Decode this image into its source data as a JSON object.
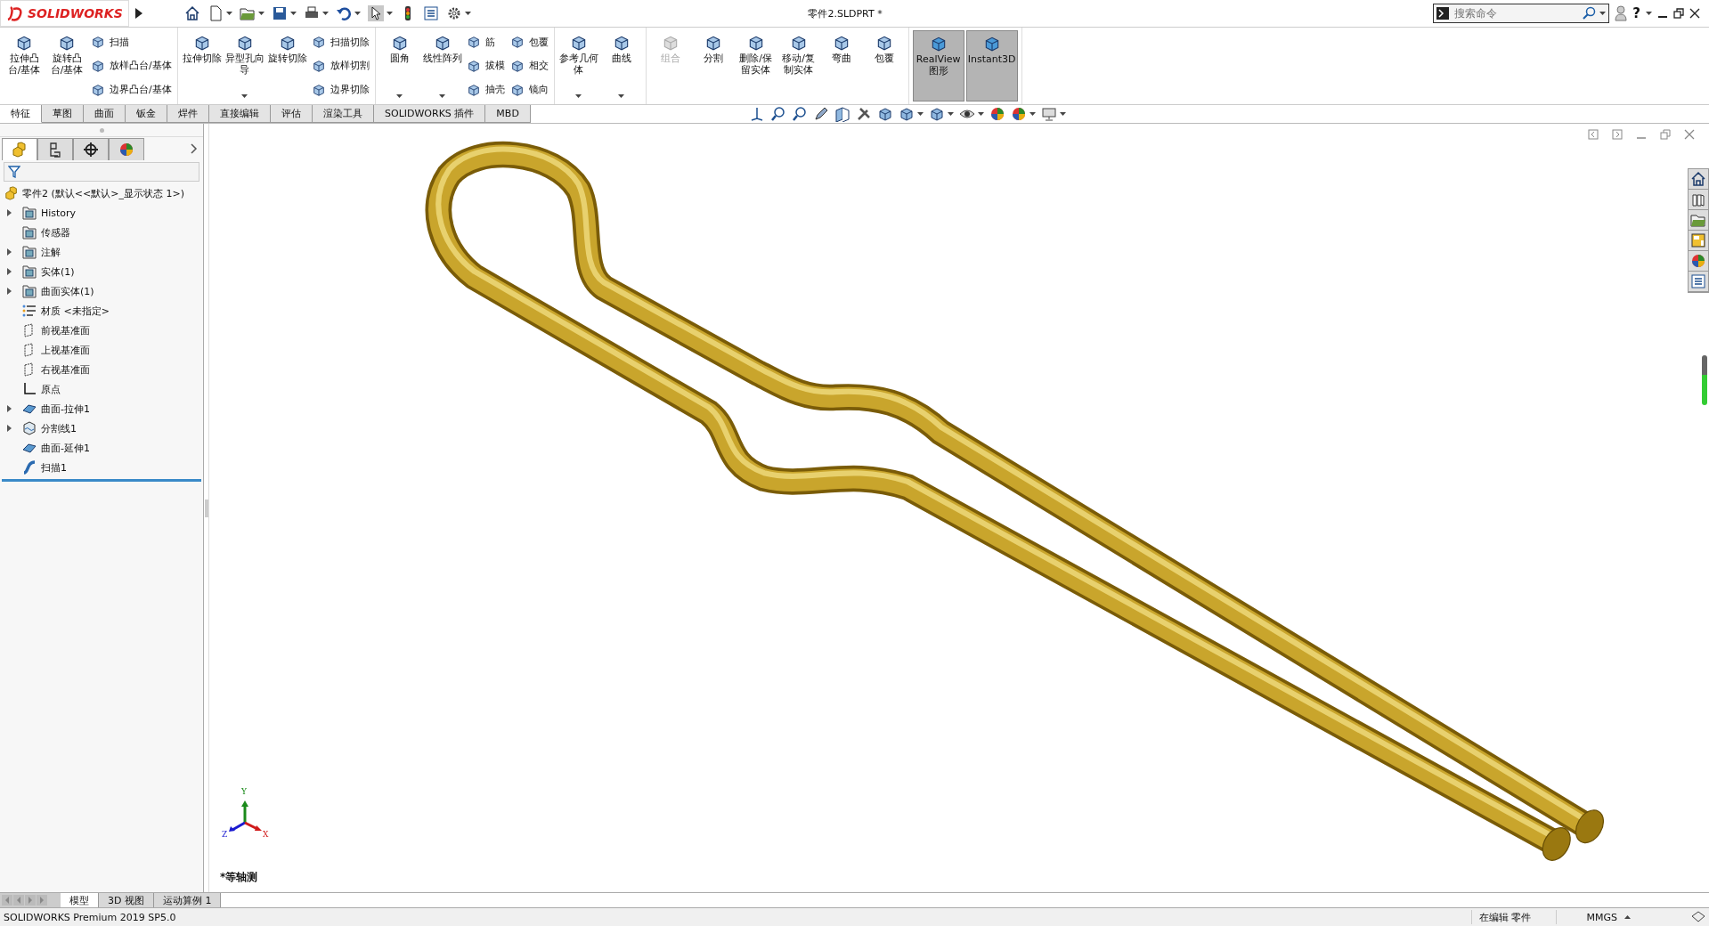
{
  "title_bar": {
    "logo": "SOLIDWORKS",
    "document_title": "零件2.SLDPRT *",
    "search": {
      "placeholder": "搜索命令"
    },
    "help": "?"
  },
  "ribbon": {
    "groups": [
      {
        "columns": [
          {
            "kind": "large",
            "label": "拉伸凸台/基体",
            "dropdown": false,
            "disabled": false,
            "pressed": false
          },
          {
            "kind": "large",
            "label": "旋转凸台/基体",
            "dropdown": false,
            "disabled": false,
            "pressed": false
          },
          {
            "kind": "stack",
            "items": [
              "扫描",
              "放样凸台/基体",
              "边界凸台/基体"
            ]
          }
        ]
      },
      {
        "columns": [
          {
            "kind": "large",
            "label": "拉伸切除",
            "dropdown": false,
            "disabled": false,
            "pressed": false
          },
          {
            "kind": "large",
            "label": "异型孔向导",
            "dropdown": true,
            "disabled": false,
            "pressed": false
          },
          {
            "kind": "large",
            "label": "旋转切除",
            "dropdown": false,
            "disabled": false,
            "pressed": false
          },
          {
            "kind": "stack",
            "items": [
              "扫描切除",
              "放样切割",
              "边界切除"
            ]
          }
        ]
      },
      {
        "columns": [
          {
            "kind": "large",
            "label": "圆角",
            "dropdown": true,
            "disabled": false,
            "pressed": false
          },
          {
            "kind": "large",
            "label": "线性阵列",
            "dropdown": true,
            "disabled": false,
            "pressed": false
          },
          {
            "kind": "stack",
            "items": [
              "筋",
              "拔模",
              "抽壳"
            ]
          },
          {
            "kind": "stack",
            "items": [
              "包覆",
              "相交",
              "镜向"
            ]
          }
        ]
      },
      {
        "columns": [
          {
            "kind": "large",
            "label": "参考几何体",
            "dropdown": true,
            "disabled": false,
            "pressed": false
          },
          {
            "kind": "large",
            "label": "曲线",
            "dropdown": true,
            "disabled": false,
            "pressed": false
          }
        ]
      },
      {
        "columns": [
          {
            "kind": "large",
            "label": "组合",
            "dropdown": false,
            "disabled": true,
            "pressed": false
          },
          {
            "kind": "large",
            "label": "分割",
            "dropdown": false,
            "disabled": false,
            "pressed": false
          },
          {
            "kind": "large",
            "label": "删除/保留实体",
            "dropdown": false,
            "disabled": false,
            "pressed": false
          },
          {
            "kind": "large",
            "label": "移动/复制实体",
            "dropdown": false,
            "disabled": false,
            "pressed": false
          },
          {
            "kind": "large",
            "label": "弯曲",
            "dropdown": false,
            "disabled": false,
            "pressed": false
          },
          {
            "kind": "large",
            "label": "包覆",
            "dropdown": false,
            "disabled": false,
            "pressed": false
          }
        ]
      },
      {
        "columns": [
          {
            "kind": "large",
            "label": "RealView 图形",
            "dropdown": false,
            "disabled": false,
            "pressed": true
          },
          {
            "kind": "large",
            "label": "Instant3D",
            "dropdown": false,
            "disabled": false,
            "pressed": true
          }
        ]
      }
    ]
  },
  "command_tabs": [
    {
      "label": "特征",
      "selected": true
    },
    {
      "label": "草图",
      "selected": false
    },
    {
      "label": "曲面",
      "selected": false
    },
    {
      "label": "钣金",
      "selected": false
    },
    {
      "label": "焊件",
      "selected": false
    },
    {
      "label": "直接编辑",
      "selected": false
    },
    {
      "label": "评估",
      "selected": false
    },
    {
      "label": "渲染工具",
      "selected": false
    },
    {
      "label": "SOLIDWORKS 插件",
      "selected": false
    },
    {
      "label": "MBD",
      "selected": false
    }
  ],
  "feature_manager": {
    "root": {
      "label": "零件2  (默认<<默认>_显示状态 1>)",
      "children": [
        {
          "label": "History",
          "kind": "folder",
          "collapsible": true
        },
        {
          "label": "传感器",
          "kind": "folder",
          "collapsible": false
        },
        {
          "label": "注解",
          "kind": "folder",
          "collapsible": true
        },
        {
          "label": "实体(1)",
          "kind": "folder",
          "collapsible": true
        },
        {
          "label": "曲面实体(1)",
          "kind": "folder",
          "collapsible": true
        },
        {
          "label": "材质 <未指定>",
          "kind": "material",
          "collapsible": false
        },
        {
          "label": "前视基准面",
          "kind": "plane",
          "collapsible": false
        },
        {
          "label": "上视基准面",
          "kind": "plane",
          "collapsible": false
        },
        {
          "label": "右视基准面",
          "kind": "plane",
          "collapsible": false
        },
        {
          "label": "原点",
          "kind": "origin",
          "collapsible": false
        },
        {
          "label": "曲面-拉伸1",
          "kind": "surface",
          "collapsible": true
        },
        {
          "label": "分割线1",
          "kind": "split",
          "collapsible": true
        },
        {
          "label": "曲面-延伸1",
          "kind": "surface",
          "collapsible": false
        },
        {
          "label": "扫描1",
          "kind": "sweep",
          "collapsible": false
        }
      ]
    }
  },
  "viewport": {
    "view_label": "*等轴测",
    "triad": {
      "x": "X",
      "y": "Y",
      "z": "Z"
    }
  },
  "bottom_tabs": [
    {
      "label": "模型",
      "selected": true
    },
    {
      "label": "3D 视图",
      "selected": false
    },
    {
      "label": "运动算例 1",
      "selected": false
    }
  ],
  "status_bar": {
    "version": "SOLIDWORKS Premium 2019 SP5.0",
    "mode": "在编辑 零件",
    "units": "MMGS"
  }
}
